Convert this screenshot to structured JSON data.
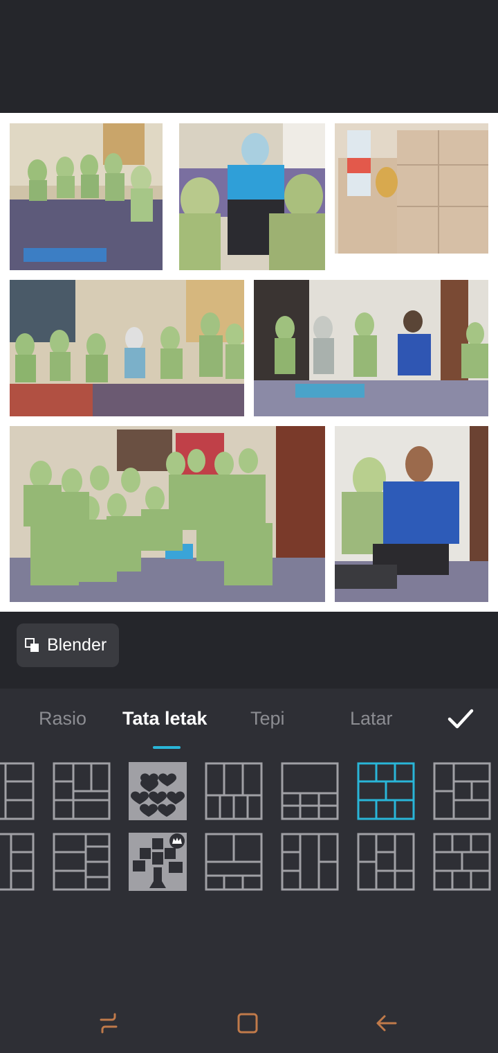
{
  "blender": {
    "label": "Blender"
  },
  "tabs": [
    {
      "label": "Rasio"
    },
    {
      "label": "Tata letak"
    },
    {
      "label": "Tepi"
    },
    {
      "label": "Latar"
    }
  ],
  "active_tab": "Tata letak",
  "colors": {
    "accent": "#29b6d8",
    "background": "#25262b",
    "panel": "#2e2f35",
    "layout_outline": "#a0a0a5",
    "nav_icon": "#c07a4a"
  },
  "photos": [
    {
      "name": "photo-women-seated-circle",
      "description_icon": "photo-icon"
    },
    {
      "name": "photo-speaker-blue-hijab",
      "description_icon": "photo-icon"
    },
    {
      "name": "photo-snack-boxes-water",
      "description_icon": "photo-icon"
    },
    {
      "name": "photo-women-sitting-room",
      "description_icon": "photo-icon"
    },
    {
      "name": "photo-man-blue-batik-group",
      "description_icon": "photo-icon"
    },
    {
      "name": "photo-group-portrait",
      "description_icon": "photo-icon"
    },
    {
      "name": "photo-man-blue-batik-closeup",
      "description_icon": "photo-icon"
    }
  ],
  "layouts": {
    "selected_index": 5,
    "row1": [
      "layout-partial-left",
      "layout-grid-2x3",
      "layout-hearts",
      "layout-3over4",
      "layout-wide-top-6-bottom",
      "layout-brick",
      "layout-partial-right"
    ],
    "row2": [
      "layout-partial-left-2",
      "layout-2col-rows",
      "layout-tree-premium",
      "layout-wide-3-rows",
      "layout-2col-split",
      "layout-mixed-grid",
      "layout-partial-right-2"
    ]
  },
  "navbar": {
    "icons": [
      "recent-apps-icon",
      "home-icon",
      "back-icon"
    ]
  }
}
